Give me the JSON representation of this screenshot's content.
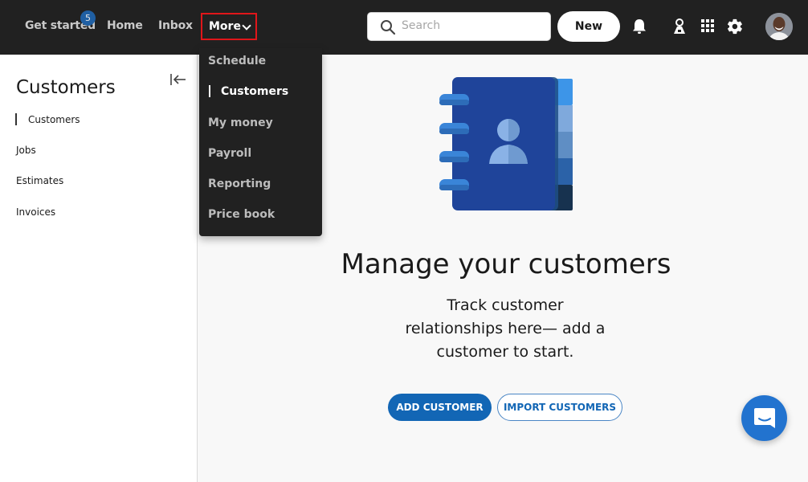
{
  "topbar": {
    "nav": [
      {
        "label": "Get started",
        "badge": "5"
      },
      {
        "label": "Home"
      },
      {
        "label": "Inbox"
      },
      {
        "label": "More"
      }
    ],
    "search": {
      "placeholder": "Search",
      "value": ""
    },
    "new_label": "New",
    "icons": [
      "bell-icon",
      "map-pin-person-icon",
      "apps-grid-icon",
      "gear-icon"
    ],
    "avatar": "user-avatar"
  },
  "dropdown": {
    "items": [
      {
        "label": "Schedule"
      },
      {
        "label": "Customers",
        "active": true
      },
      {
        "label": "My money"
      },
      {
        "label": "Payroll"
      },
      {
        "label": "Reporting"
      },
      {
        "label": "Price book"
      }
    ]
  },
  "sidebar": {
    "title": "Customers",
    "items": [
      {
        "label": "Customers",
        "active": true
      },
      {
        "label": "Jobs"
      },
      {
        "label": "Estimates"
      },
      {
        "label": "Invoices"
      }
    ]
  },
  "main": {
    "headline": "Manage your customers",
    "subtext": "Track customer relationships here— add a customer to start.",
    "primary_button": "ADD CUSTOMER",
    "secondary_button": "IMPORT CUSTOMERS"
  },
  "colors": {
    "topbar_bg": "#212121",
    "accent": "#1266b5",
    "highlight_border": "#e0161a",
    "chat_fab": "#2273cf"
  }
}
